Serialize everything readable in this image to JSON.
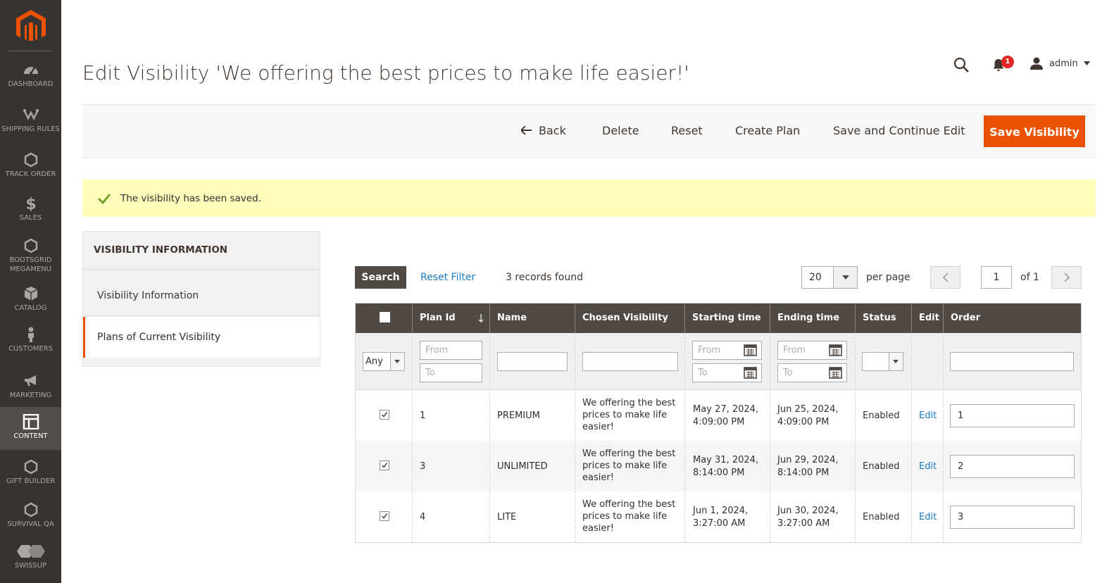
{
  "app": {
    "title": "Edit Visibility 'We offering the best prices to make life easier!'",
    "accent_color": "#eb5202",
    "sidebar_color": "#373330"
  },
  "sidebar": {
    "items": [
      {
        "label": "DASHBOARD",
        "icon": "dashboard-icon"
      },
      {
        "label": "SHIPPING RULES",
        "icon": "shipping-icon"
      },
      {
        "label": "TRACK ORDER",
        "icon": "hexagon-icon"
      },
      {
        "label": "SALES",
        "icon": "dollar-icon"
      },
      {
        "label": "BOOTSGRID MEGAMENU",
        "icon": "hexagon-icon"
      },
      {
        "label": "CATALOG",
        "icon": "box-icon"
      },
      {
        "label": "CUSTOMERS",
        "icon": "person-icon"
      },
      {
        "label": "MARKETING",
        "icon": "megaphone-icon"
      },
      {
        "label": "CONTENT",
        "icon": "layout-icon",
        "active": true
      },
      {
        "label": "GIFT BUILDER",
        "icon": "hexagon-icon"
      },
      {
        "label": "SURVIVAL QA",
        "icon": "hexagon-icon"
      },
      {
        "label": "SWISSUP",
        "icon": "swissup-icon"
      }
    ]
  },
  "header": {
    "notifications_count": "1",
    "user": "admin"
  },
  "actions": {
    "back": "Back",
    "delete": "Delete",
    "reset": "Reset",
    "create_plan": "Create Plan",
    "save_continue": "Save and Continue Edit",
    "save": "Save Visibility"
  },
  "message": "The visibility has been saved.",
  "tabs": {
    "heading": "VISIBILITY INFORMATION",
    "items": [
      {
        "label": "Visibility Information"
      },
      {
        "label": "Plans of Current Visibility",
        "active": true
      }
    ]
  },
  "grid": {
    "search_label": "Search",
    "reset_filter": "Reset Filter",
    "records": "3 records found",
    "per_page_value": "20",
    "per_page_label": "per page",
    "page_value": "1",
    "page_of": "of 1",
    "columns": [
      "Plan Id",
      "Name",
      "Chosen Visibility",
      "Starting time",
      "Ending time",
      "Status",
      "Edit",
      "Order"
    ],
    "filters": {
      "any": "Any",
      "from": "From",
      "to": "To"
    },
    "rows": [
      {
        "id": "1",
        "name": "PREMIUM",
        "visibility": "We offering the best prices to make life easier!",
        "start_date": "May 27, 2024,",
        "start_time": "4:09:00 PM",
        "end_date": "Jun 25, 2024,",
        "end_time": "4:09:00 PM",
        "status": "Enabled",
        "edit": "Edit",
        "order": "1"
      },
      {
        "id": "3",
        "name": "UNLIMITED",
        "visibility": "We offering the best prices to make life easier!",
        "start_date": "May 31, 2024,",
        "start_time": "8:14:00 PM",
        "end_date": "Jun 29, 2024,",
        "end_time": "8:14:00 PM",
        "status": "Enabled",
        "edit": "Edit",
        "order": "2"
      },
      {
        "id": "4",
        "name": "LITE",
        "visibility": "We offering the best prices to make life easier!",
        "start_date": "Jun 1, 2024,",
        "start_time": "3:27:00 AM",
        "end_date": "Jun 30, 2024,",
        "end_time": "3:27:00 AM",
        "status": "Enabled",
        "edit": "Edit",
        "order": "3"
      }
    ]
  }
}
